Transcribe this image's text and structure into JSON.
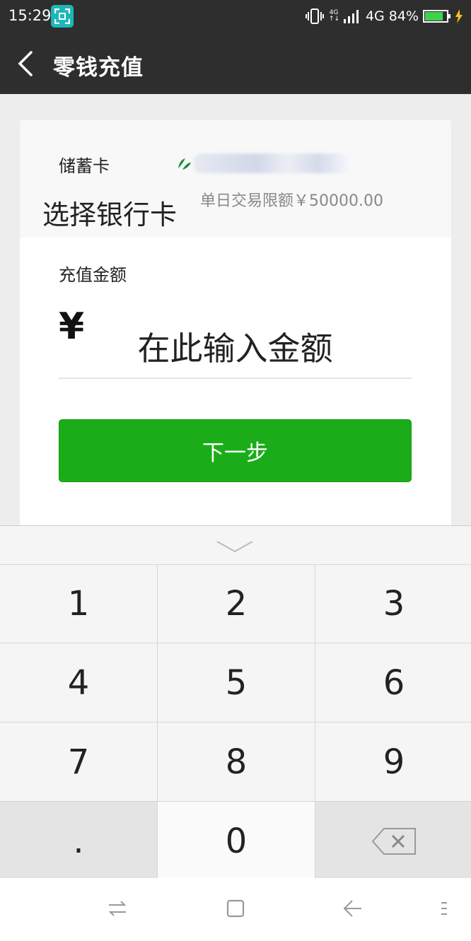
{
  "status_bar": {
    "time": "15:29",
    "network_small_top": "4G",
    "network_small_bottom": "↑↓",
    "network": "4G",
    "battery": "84%",
    "battery_level": 0.84,
    "icons": [
      "screenshot-scan-icon",
      "vibrate-icon",
      "signal-icon",
      "battery-icon",
      "charging-bolt-icon"
    ]
  },
  "header": {
    "title": "零钱充值"
  },
  "bank": {
    "card_type": "储蓄卡",
    "limit": "单日交易限额￥50000.00",
    "choose_card": "选择银行卡"
  },
  "amount": {
    "label": "充值金额",
    "currency": "¥",
    "placeholder": "在此输入金额"
  },
  "next_button": "下一步",
  "keypad": {
    "keys": [
      "1",
      "2",
      "3",
      "4",
      "5",
      "6",
      "7",
      "8",
      "9",
      ".",
      "0"
    ]
  },
  "colors": {
    "header_bg": "#2e2e2e",
    "button_green": "#1aad19",
    "page_bg": "#ededed"
  }
}
